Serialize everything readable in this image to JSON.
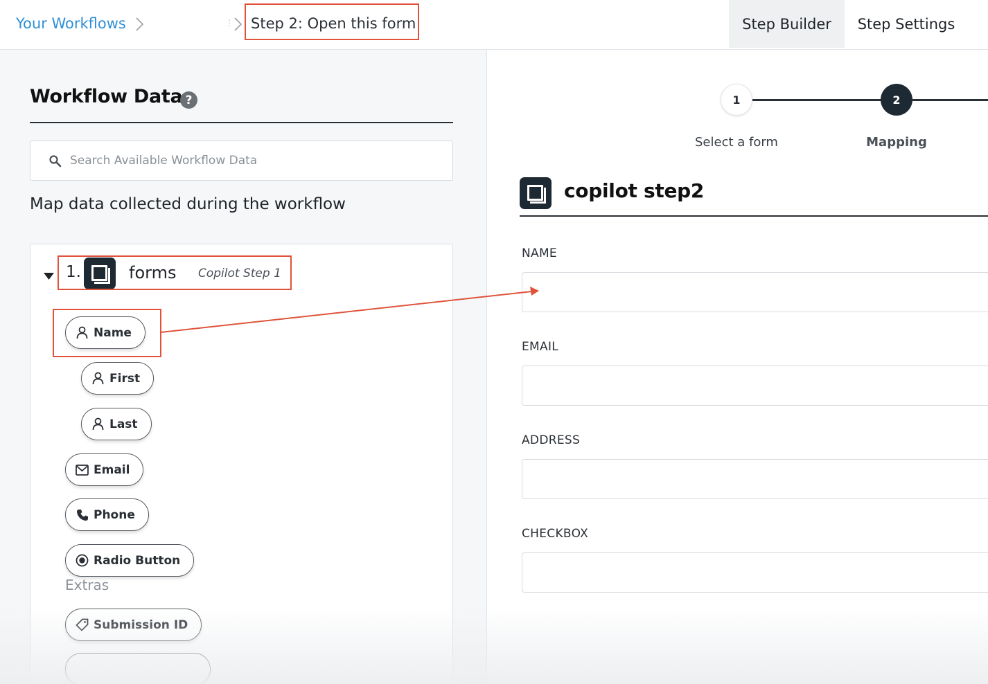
{
  "topbar": {
    "breadcrumb_home": "Your Workflows",
    "breadcrumb_current": "Step 2: Open this form",
    "tabs": [
      {
        "label": "Step Builder",
        "active": true
      },
      {
        "label": "Step Settings",
        "active": false
      }
    ]
  },
  "left_panel": {
    "title": "Workflow Data",
    "help_icon": "?",
    "search_placeholder": "Search Available Workflow Data",
    "map_text": "Map data collected during the workflow",
    "source": {
      "number": "1.",
      "name": "forms",
      "step": "Copilot Step 1"
    },
    "fields": [
      {
        "label": "Name",
        "icon": "person-icon"
      },
      {
        "label": "First",
        "icon": "person-icon"
      },
      {
        "label": "Last",
        "icon": "person-icon"
      },
      {
        "label": "Email",
        "icon": "envelope-icon"
      },
      {
        "label": "Phone",
        "icon": "phone-icon"
      },
      {
        "label": "Radio Button",
        "icon": "radio-icon"
      }
    ],
    "extras_label": "Extras",
    "extras": [
      {
        "label": "Submission ID",
        "icon": "tag-icon"
      }
    ]
  },
  "right_panel": {
    "stepper": [
      {
        "number": "1",
        "label": "Select a form",
        "state": "done"
      },
      {
        "number": "2",
        "label": "Mapping",
        "state": "active"
      }
    ],
    "form_title": "copilot step2",
    "form_fields": [
      {
        "label": "NAME",
        "value": ""
      },
      {
        "label": "EMAIL",
        "value": ""
      },
      {
        "label": "ADDRESS",
        "value": ""
      },
      {
        "label": "CHECKBOX",
        "value": ""
      }
    ]
  },
  "colors": {
    "link": "#2f8fd6",
    "annotation": "#e0533a",
    "dark_badge": "#1e2a33",
    "panel_bg": "#f5f7f9"
  }
}
